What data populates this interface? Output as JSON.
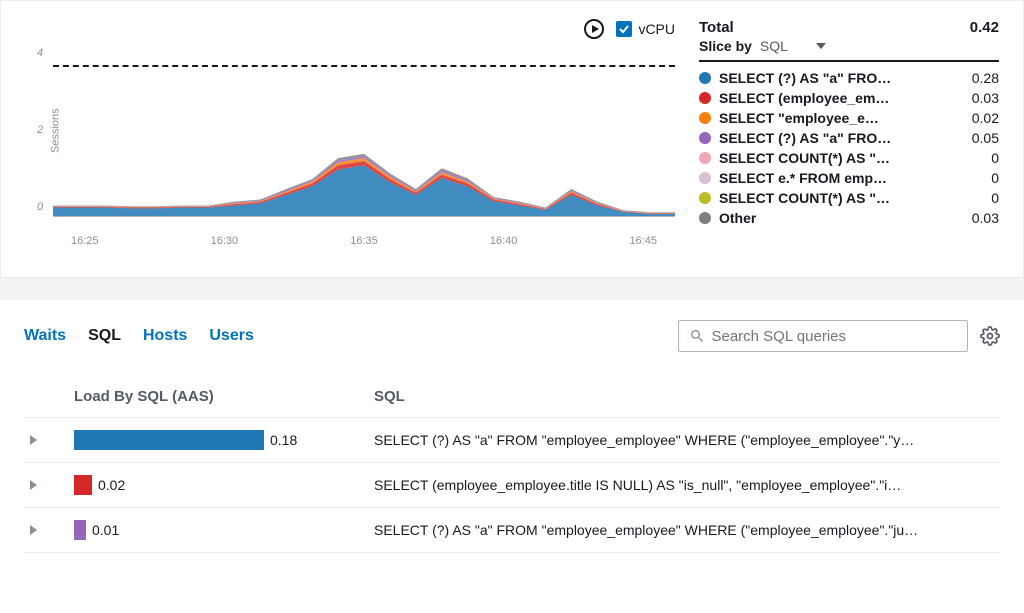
{
  "controls": {
    "vcpu_label": "vCPU"
  },
  "totals": {
    "label": "Total",
    "value": "0.42"
  },
  "slice": {
    "label": "Slice by",
    "value": "SQL"
  },
  "legend": [
    {
      "color": "#1f77b4",
      "text": "SELECT (?) AS \"a\" FRO…",
      "value": "0.28"
    },
    {
      "color": "#d62728",
      "text": "SELECT (employee_em…",
      "value": "0.03"
    },
    {
      "color": "#ff7f0e",
      "text": "SELECT \"employee_e…",
      "value": "0.02"
    },
    {
      "color": "#9467bd",
      "text": "SELECT (?) AS \"a\" FRO…",
      "value": "0.05"
    },
    {
      "color": "#f4a6b7",
      "text": "SELECT COUNT(*) AS \"…",
      "value": "0"
    },
    {
      "color": "#d8bfd8",
      "text": "SELECT e.* FROM emp…",
      "value": "0"
    },
    {
      "color": "#bcbd22",
      "text": "SELECT COUNT(*) AS \"…",
      "value": "0"
    },
    {
      "color": "#7f7f7f",
      "text": "Other",
      "value": "0.03"
    }
  ],
  "chart_data": {
    "type": "area",
    "title": "",
    "xlabel": "",
    "ylabel": "Sessions",
    "ylim": [
      0,
      4
    ],
    "y_ticks": [
      "4",
      "2",
      "0"
    ],
    "x_ticks": [
      "16:25",
      "16:30",
      "16:35",
      "16:40",
      "16:45"
    ],
    "max_reference": 4,
    "series": [
      {
        "name": "SELECT (?) AS \"a\" FRO…",
        "color": "#1f77b4",
        "values": [
          0.2,
          0.2,
          0.2,
          0.18,
          0.18,
          0.2,
          0.2,
          0.25,
          0.3,
          0.5,
          0.7,
          1.1,
          1.2,
          0.8,
          0.5,
          0.9,
          0.7,
          0.35,
          0.25,
          0.15,
          0.5,
          0.25,
          0.1,
          0.05,
          0.05
        ]
      },
      {
        "name": "SELECT (employee_em…",
        "color": "#d62728",
        "values": [
          0.02,
          0.02,
          0.02,
          0.02,
          0.02,
          0.02,
          0.02,
          0.03,
          0.03,
          0.05,
          0.07,
          0.1,
          0.1,
          0.08,
          0.05,
          0.08,
          0.07,
          0.04,
          0.03,
          0.02,
          0.05,
          0.03,
          0.01,
          0.01,
          0.01
        ]
      },
      {
        "name": "SELECT \"employee_e…",
        "color": "#ff7f0e",
        "values": [
          0.01,
          0.01,
          0.01,
          0.01,
          0.01,
          0.01,
          0.01,
          0.02,
          0.02,
          0.03,
          0.04,
          0.07,
          0.07,
          0.05,
          0.03,
          0.05,
          0.04,
          0.02,
          0.02,
          0.01,
          0.03,
          0.02,
          0.01,
          0.01,
          0.01
        ]
      },
      {
        "name": "SELECT (?) AS \"a\" FRO…",
        "color": "#9467bd",
        "values": [
          0.01,
          0.01,
          0.01,
          0.01,
          0.01,
          0.01,
          0.01,
          0.02,
          0.02,
          0.03,
          0.03,
          0.05,
          0.05,
          0.04,
          0.03,
          0.05,
          0.04,
          0.02,
          0.02,
          0.01,
          0.03,
          0.02,
          0.01,
          0.01,
          0.01
        ]
      },
      {
        "name": "Other",
        "color": "#7f7f7f",
        "values": [
          0.01,
          0.01,
          0.01,
          0.01,
          0.01,
          0.01,
          0.01,
          0.02,
          0.02,
          0.03,
          0.03,
          0.05,
          0.05,
          0.04,
          0.03,
          0.05,
          0.04,
          0.02,
          0.02,
          0.01,
          0.03,
          0.02,
          0.01,
          0.01,
          0.01
        ]
      }
    ]
  },
  "tabs": {
    "waits": "Waits",
    "sql": "SQL",
    "hosts": "Hosts",
    "users": "Users",
    "active": "sql"
  },
  "search": {
    "placeholder": "Search SQL queries"
  },
  "table": {
    "header_load": "Load By SQL (AAS)",
    "header_sql": "SQL",
    "rows": [
      {
        "color": "#1f77b4",
        "width": 190,
        "value": "0.18",
        "sql": "SELECT (?) AS \"a\" FROM \"employee_employee\" WHERE (\"employee_employee\".\"y…"
      },
      {
        "color": "#d62728",
        "width": 18,
        "value": "0.02",
        "sql": "SELECT (employee_employee.title IS NULL) AS \"is_null\", \"employee_employee\".\"i…"
      },
      {
        "color": "#9467bd",
        "width": 12,
        "value": "0.01",
        "sql": "SELECT (?) AS \"a\" FROM \"employee_employee\" WHERE (\"employee_employee\".\"ju…"
      }
    ]
  }
}
